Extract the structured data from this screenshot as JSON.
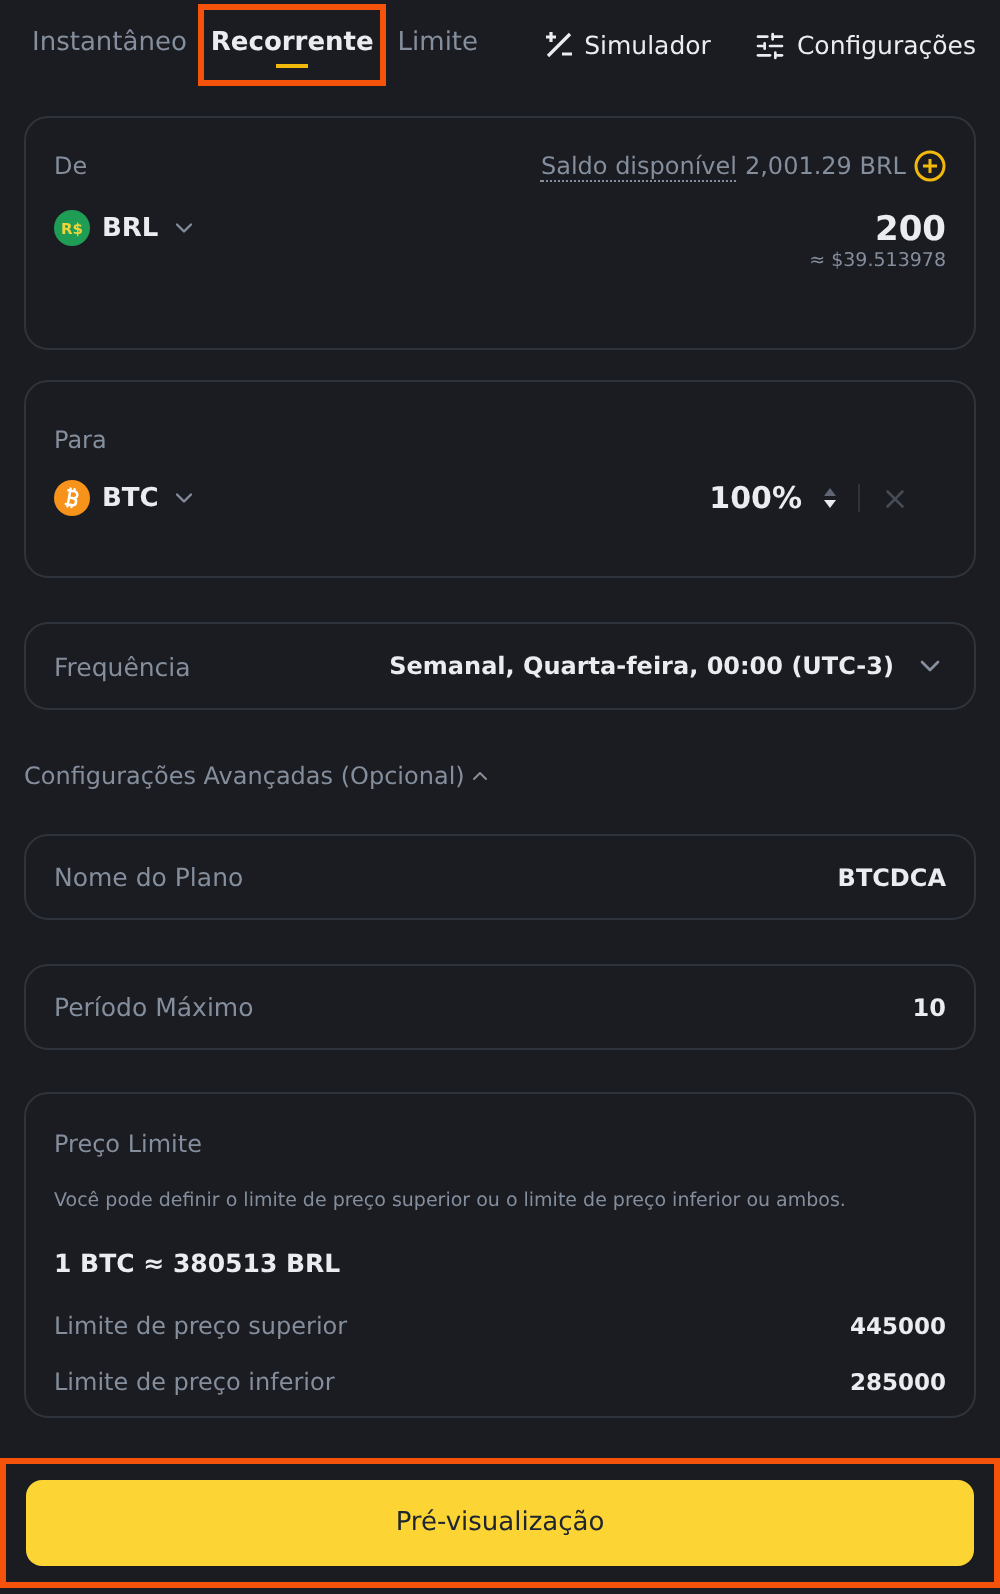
{
  "tabs": [
    {
      "label": "Instantâneo",
      "selected": false,
      "highlighted": false
    },
    {
      "label": "Recorrente",
      "selected": true,
      "highlighted": true
    },
    {
      "label": "Limite",
      "selected": false,
      "highlighted": false
    }
  ],
  "tools": [
    {
      "label": "Simulador",
      "kind": "simulator"
    },
    {
      "label": "Configurações",
      "kind": "settings"
    }
  ],
  "from": {
    "label": "De",
    "balance_label": "Saldo disponível",
    "balance": "2,001.29 BRL",
    "coin_symbol": "R$",
    "currency": "BRL",
    "amount": "200",
    "usd_value": "≈ $39.513978"
  },
  "to": {
    "label": "Para",
    "currency": "BTC",
    "percent": "100%"
  },
  "frequency": {
    "label": "Frequência",
    "value": "Semanal, Quarta-feira, 00:00 (UTC-3)"
  },
  "advanced": {
    "label": "Configurações Avançadas (Opcional)",
    "expanded": true
  },
  "fields": [
    {
      "label": "Nome do Plano",
      "value": "BTCDCA"
    },
    {
      "label": "Período Máximo",
      "value": "10"
    }
  ],
  "price_limit": {
    "title": "Preço Limite",
    "hint": "Você pode definir o limite de preço superior ou o limite de preço inferior ou ambos.",
    "rate": "1 BTC ≈ 380513 BRL",
    "rows": [
      {
        "label": "Limite de preço superior",
        "value": "445000"
      },
      {
        "label": "Limite de preço inferior",
        "value": "285000"
      }
    ]
  },
  "preview_button": {
    "label": "Pré-visualização",
    "highlighted": true
  }
}
